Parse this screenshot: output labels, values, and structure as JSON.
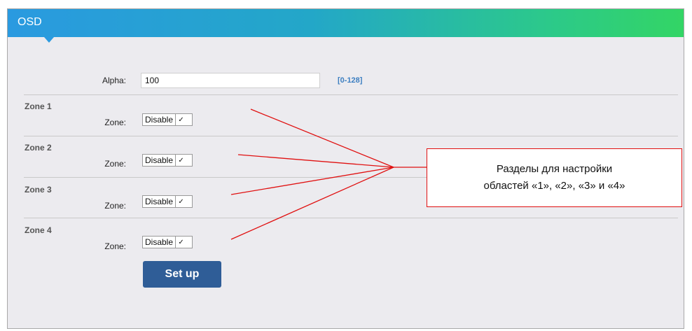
{
  "header": {
    "title": "OSD"
  },
  "alpha": {
    "label": "Alpha:",
    "value": "100",
    "range": "[0-128]"
  },
  "zones": [
    {
      "title": "Zone 1",
      "label": "Zone:",
      "selected": "Disable"
    },
    {
      "title": "Zone 2",
      "label": "Zone:",
      "selected": "Disable"
    },
    {
      "title": "Zone 3",
      "label": "Zone:",
      "selected": "Disable"
    },
    {
      "title": "Zone 4",
      "label": "Zone:",
      "selected": "Disable"
    }
  ],
  "setup_button": {
    "label": "Set up"
  },
  "annotation": {
    "line1": "Разделы для настройки",
    "line2": "областей «1», «2», «3» и «4»",
    "color": "#e01010"
  },
  "colors": {
    "header_start": "#2a9ae0",
    "header_end": "#33d565",
    "button": "#2f5d97",
    "range_text": "#3d7fc1"
  }
}
